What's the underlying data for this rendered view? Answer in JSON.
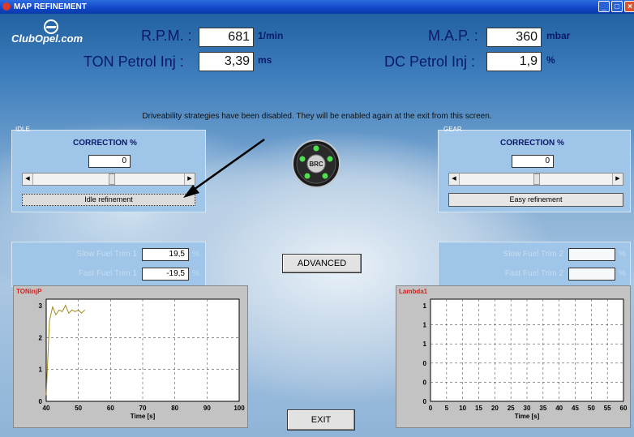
{
  "window": {
    "title": "MAP REFINEMENT"
  },
  "logo": {
    "text": "ClubOpel.com"
  },
  "readouts": {
    "rpm": {
      "label": "R.P.M. :",
      "value": "681",
      "unit": "1/min"
    },
    "map": {
      "label": "M.A.P. :",
      "value": "360",
      "unit": "mbar"
    },
    "ton": {
      "label": "TON Petrol Inj :",
      "value": "3,39",
      "unit": "ms"
    },
    "dc": {
      "label": "DC Petrol Inj :",
      "value": "1,9",
      "unit": "%"
    }
  },
  "notice": "Driveability strategies have been disabled. They will be enabled again at the exit from this screen.",
  "idle": {
    "title": "IDLE",
    "correction_label": "CORRECTION %",
    "correction_value": "0",
    "button": "Idle refinement"
  },
  "gear": {
    "title": "GEAR",
    "correction_label": "CORRECTION %",
    "correction_value": "0",
    "button": "Easy refinement"
  },
  "brc_logo": "BRC",
  "left_trims": {
    "slow": {
      "label": "Slow Fuel Trim 1",
      "value": "19,5",
      "unit": "%"
    },
    "fast": {
      "label": "Fast Fuel Trim 1",
      "value": "-19,5",
      "unit": "%"
    }
  },
  "right_trims": {
    "slow": {
      "label": "Slow Fuel Trim 2",
      "value": "",
      "unit": "%"
    },
    "fast": {
      "label": "Fast Fuel Trim 2",
      "value": "",
      "unit": "%"
    }
  },
  "buttons": {
    "advanced": "ADVANCED",
    "exit": "EXIT"
  },
  "graph_left": {
    "title": "TONinjP",
    "xlabel": "Time [s]",
    "x_ticks": [
      "40",
      "50",
      "60",
      "70",
      "80",
      "90",
      "100"
    ],
    "y_ticks": [
      "3",
      "2",
      "1",
      "0"
    ],
    "series_color": "#a08a18"
  },
  "graph_right": {
    "title": "Lambda1",
    "xlabel": "Time [s]",
    "x_ticks": [
      "0",
      "5",
      "10",
      "15",
      "20",
      "25",
      "30",
      "35",
      "40",
      "45",
      "50",
      "55",
      "60"
    ],
    "y_ticks": [
      "1",
      "1",
      "1",
      "0",
      "0",
      "0"
    ]
  },
  "chart_data": [
    {
      "type": "line",
      "title": "TONinjP",
      "xlabel": "Time [s]",
      "xlim": [
        40,
        100
      ],
      "ylim": [
        0,
        3.3
      ],
      "series": [
        {
          "x": [
            40,
            41,
            42,
            43,
            44,
            45,
            46,
            47,
            48,
            49,
            50,
            51,
            52
          ],
          "y": [
            0.2,
            2.6,
            3.05,
            2.8,
            2.95,
            2.9,
            3.1,
            2.85,
            2.95,
            2.9,
            2.95,
            2.85,
            2.95
          ]
        }
      ]
    },
    {
      "type": "line",
      "title": "Lambda1",
      "xlabel": "Time [s]",
      "xlim": [
        0,
        60
      ],
      "series": []
    }
  ]
}
